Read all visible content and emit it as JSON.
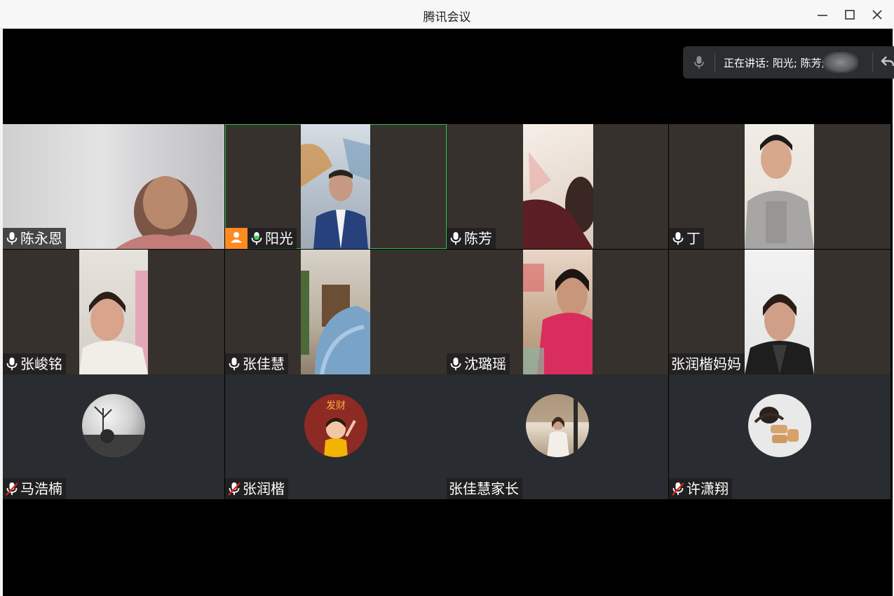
{
  "window": {
    "title": "腾讯会议",
    "controls": [
      "minimize-icon",
      "maximize-icon",
      "close-icon"
    ]
  },
  "speaker_bar": {
    "text": "正在讲话: 阳光; 陈芳;",
    "icons": [
      "mic-icon",
      "back-arrow-icon"
    ]
  },
  "participants": [
    {
      "name": "陈永恩",
      "mic": "on",
      "type": "video"
    },
    {
      "name": "阳光",
      "mic": "talking",
      "type": "video",
      "host": true,
      "active": true
    },
    {
      "name": "陈芳",
      "mic": "on",
      "type": "video"
    },
    {
      "name": "丁",
      "mic": "on",
      "type": "video"
    },
    {
      "name": "张峻铭",
      "mic": "on",
      "type": "video"
    },
    {
      "name": "张佳慧",
      "mic": "on",
      "type": "video"
    },
    {
      "name": "沈璐瑶",
      "mic": "on",
      "type": "video"
    },
    {
      "name": "张润楷妈妈",
      "mic": "none",
      "type": "video"
    },
    {
      "name": "马浩楠",
      "mic": "muted",
      "type": "avatar"
    },
    {
      "name": "张润楷",
      "mic": "muted",
      "type": "avatar",
      "avatar_text": "发财"
    },
    {
      "name": "张佳慧家长",
      "mic": "none",
      "type": "avatar"
    },
    {
      "name": "许潇翔",
      "mic": "muted",
      "type": "avatar"
    }
  ],
  "colors": {
    "active_border": "#25c14a",
    "host_badge": "#ff8a1f",
    "muted_slash": "#e02020",
    "tile_bg": "#36312d",
    "avatar_tile_bg": "#292c30"
  }
}
